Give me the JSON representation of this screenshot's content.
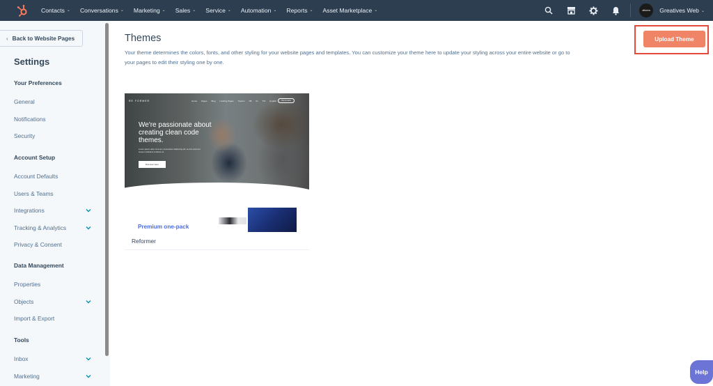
{
  "topnav": {
    "brand_color": "#ff7a59",
    "background_color": "#2d3e50",
    "items": [
      {
        "label": "Contacts"
      },
      {
        "label": "Conversations"
      },
      {
        "label": "Marketing"
      },
      {
        "label": "Sales"
      },
      {
        "label": "Service"
      },
      {
        "label": "Automation"
      },
      {
        "label": "Reports"
      },
      {
        "label": "Asset Marketplace"
      }
    ],
    "chevron": "⌄",
    "icons": [
      "search-icon",
      "marketplace-icon",
      "settings-gear-icon",
      "notifications-bell-icon"
    ],
    "avatar_text": "alforms",
    "account_name": "Greatives Web"
  },
  "sidebar": {
    "back_label": "Back to Website Pages",
    "back_chevron": "‹",
    "title": "Settings",
    "sections": [
      {
        "header": "Your Preferences",
        "items": [
          {
            "label": "General",
            "expandable": false
          },
          {
            "label": "Notifications",
            "expandable": false
          },
          {
            "label": "Security",
            "expandable": false
          }
        ]
      },
      {
        "header": "Account Setup",
        "items": [
          {
            "label": "Account Defaults",
            "expandable": false
          },
          {
            "label": "Users & Teams",
            "expandable": false
          },
          {
            "label": "Integrations",
            "expandable": true
          },
          {
            "label": "Tracking & Analytics",
            "expandable": true
          },
          {
            "label": "Privacy & Consent",
            "expandable": false
          }
        ]
      },
      {
        "header": "Data Management",
        "items": [
          {
            "label": "Properties",
            "expandable": false
          },
          {
            "label": "Objects",
            "expandable": true
          },
          {
            "label": "Import & Export",
            "expandable": false
          }
        ]
      },
      {
        "header": "Tools",
        "items": [
          {
            "label": "Inbox",
            "expandable": true
          },
          {
            "label": "Marketing",
            "expandable": true
          }
        ]
      }
    ]
  },
  "main": {
    "title": "Themes",
    "description": "Your theme determines the colors, fonts, and other styling for your website pages and templates. You can customize your theme here to update your styling across your entire website or go to your pages to edit their styling one by one.",
    "upload_button": {
      "label": "Upload Theme",
      "color": "#ef8466",
      "highlight_color": "#e8483a"
    },
    "themes": [
      {
        "name": "Reformer",
        "preview": {
          "brand": "RE FORMER",
          "nav": [
            "Home",
            "Pages",
            "Blog",
            "Landing Pages",
            "System",
            "FB",
            "IG",
            "TW",
            "English"
          ],
          "cta": "Get in touch",
          "headline": "We're passionate about creating clean code themes.",
          "subtext": "Lorem ipsum dolor sit amet, consectetur adipiscing elit, sed do eiusmod tempor incididunt ut labore et.",
          "button": "Discover Here"
        },
        "secondary_label": "Premium one-pack"
      }
    ]
  },
  "help": {
    "label": "Help",
    "color": "#6c74d6"
  }
}
